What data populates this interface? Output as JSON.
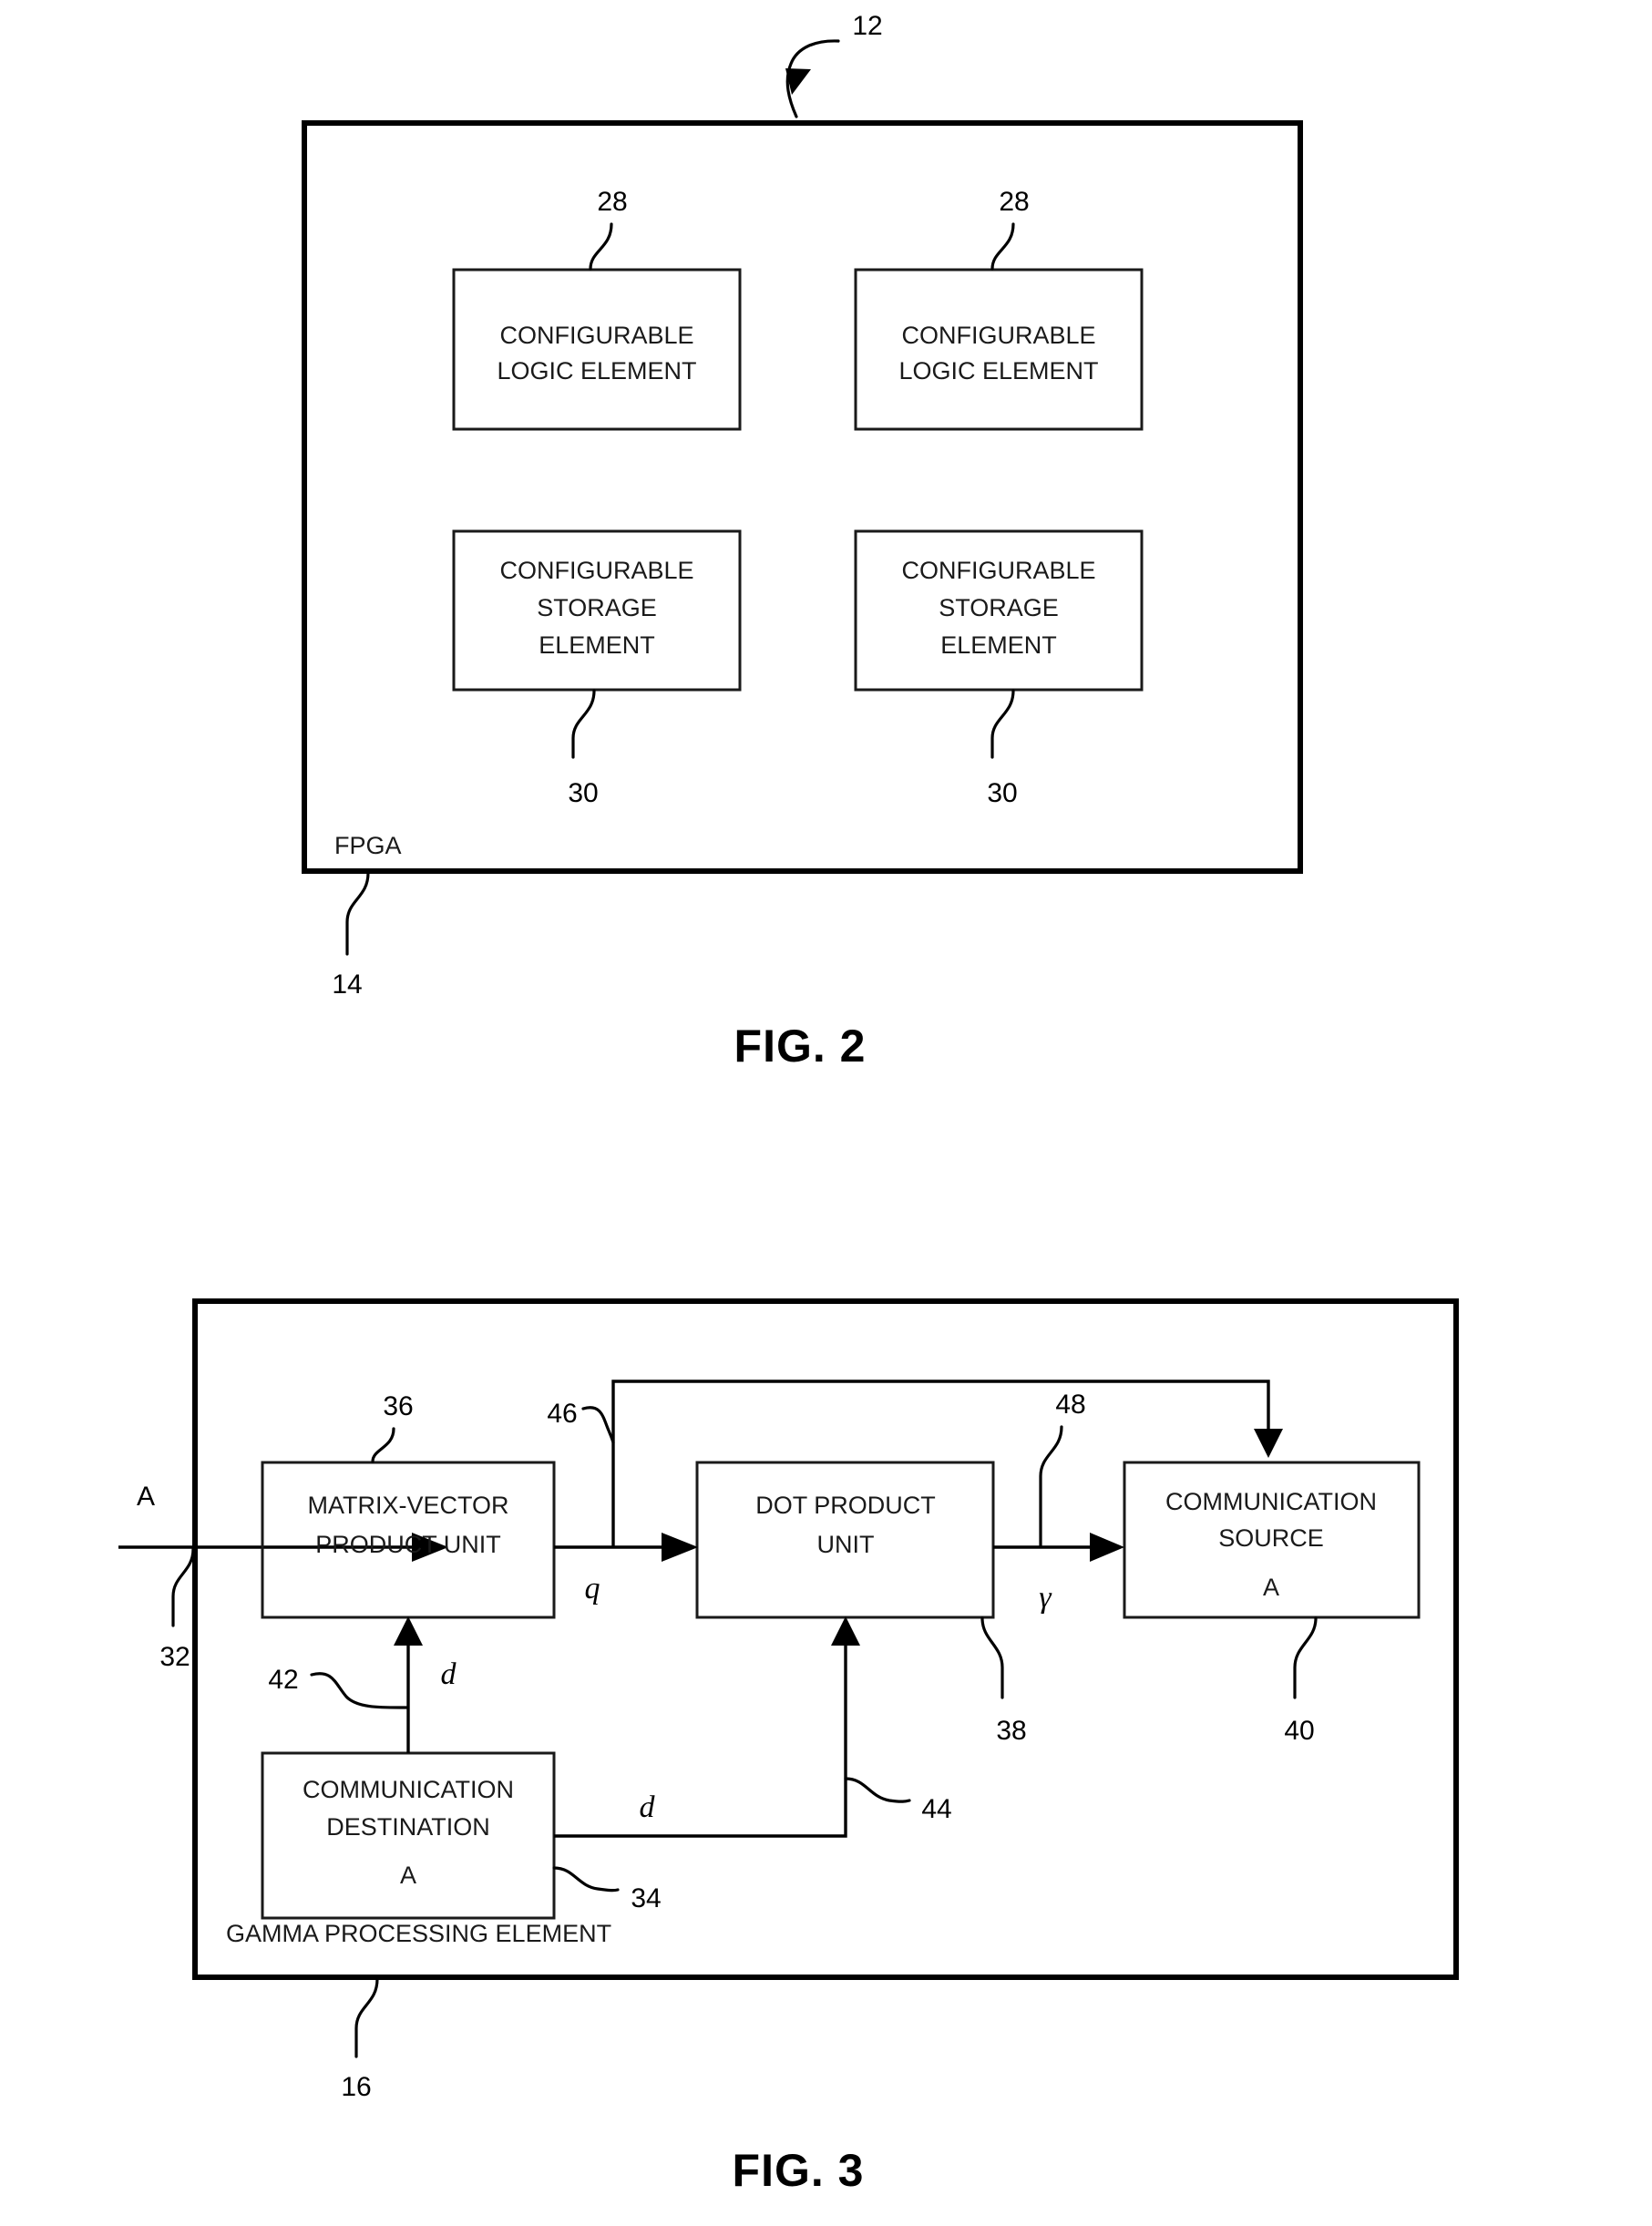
{
  "figures": [
    {
      "id": "fig2",
      "caption": "FIG. 2",
      "top_ref": "12",
      "container_label": "FPGA",
      "container_ref": "14",
      "blocks": [
        {
          "id": "cle-left",
          "ref": "28",
          "lines": [
            "CONFIGURABLE",
            "LOGIC ELEMENT"
          ]
        },
        {
          "id": "cle-right",
          "ref": "28",
          "lines": [
            "CONFIGURABLE",
            "LOGIC ELEMENT"
          ]
        },
        {
          "id": "cse-left",
          "ref": "30",
          "lines": [
            "CONFIGURABLE",
            "STORAGE",
            "ELEMENT"
          ]
        },
        {
          "id": "cse-right",
          "ref": "30",
          "lines": [
            "CONFIGURABLE",
            "STORAGE",
            "ELEMENT"
          ]
        }
      ]
    },
    {
      "id": "fig3",
      "caption": "FIG. 3",
      "container_label": "GAMMA PROCESSING ELEMENT",
      "container_ref": "16",
      "input_port_label": "A",
      "input_ref": "32",
      "blocks": [
        {
          "id": "mvpu",
          "ref": "36",
          "lines": [
            "MATRIX-VECTOR",
            "PRODUCT UNIT"
          ],
          "sub": ""
        },
        {
          "id": "dpu",
          "ref": "38",
          "lines": [
            "DOT PRODUCT",
            "UNIT"
          ],
          "sub": ""
        },
        {
          "id": "comm-source",
          "ref": "40",
          "lines": [
            "COMMUNICATION",
            "SOURCE"
          ],
          "sub": "A"
        },
        {
          "id": "comm-dest",
          "ref": "34",
          "lines": [
            "COMMUNICATION",
            "DESTINATION"
          ],
          "sub": "A"
        }
      ],
      "signals": [
        {
          "id": "q",
          "label": "q",
          "ref": "46"
        },
        {
          "id": "gamma",
          "label": "γ",
          "ref": "48"
        },
        {
          "id": "d-up",
          "label": "d",
          "ref": "42"
        },
        {
          "id": "d-right",
          "label": "d",
          "ref": "44"
        }
      ]
    }
  ],
  "colors": {
    "ink": "#000000",
    "box_ink": "#1a1a1a",
    "paper": "#ffffff"
  }
}
